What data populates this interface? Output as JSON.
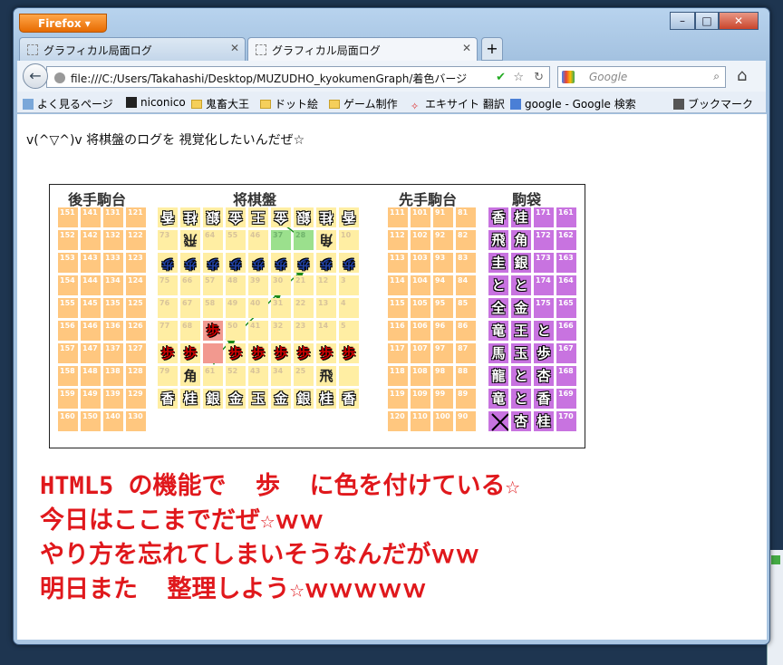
{
  "browser": {
    "app_button": "Firefox",
    "tabs": [
      {
        "title": "グラフィカル局面ログ"
      },
      {
        "title": "グラフィカル局面ログ"
      }
    ],
    "new_tab": "+",
    "url": "file:///C:/Users/Takahashi/Desktop/MUZUDHO_kyokumenGraph/着色バージ",
    "search_placeholder": "Google",
    "bookmarks": [
      {
        "label": "よく見るページ"
      },
      {
        "label": "niconico"
      },
      {
        "label": "鬼畜大王"
      },
      {
        "label": "ドット絵"
      },
      {
        "label": "ゲーム制作"
      },
      {
        "label": "エキサイト 翻訳"
      },
      {
        "label": "google - Google 検索"
      }
    ],
    "bookmark_menu": "ブックマーク",
    "window_controls": [
      "–",
      "□",
      "✕"
    ]
  },
  "page": {
    "intro": "v(^▽^)v 将棋盤のログを 視覚化したいんだぜ☆",
    "headers": {
      "gote_komadai": "後手駒台",
      "board": "将棋盤",
      "sente_komadai": "先手駒台",
      "komabukuro": "駒袋"
    },
    "messages": [
      "HTML5 の機能で  歩  に色を付けている☆",
      "今日はここまでだぜ☆ｗｗ",
      "やり方を忘れてしまいそうなんだがｗｗ",
      "明日また  整理しよう☆ｗｗｗｗｗ"
    ]
  },
  "gote_komadai": [
    [
      "151",
      "141",
      "131",
      "121"
    ],
    [
      "152",
      "142",
      "132",
      "122"
    ],
    [
      "153",
      "143",
      "133",
      "123"
    ],
    [
      "154",
      "144",
      "134",
      "124"
    ],
    [
      "155",
      "145",
      "135",
      "125"
    ],
    [
      "156",
      "146",
      "136",
      "126"
    ],
    [
      "157",
      "147",
      "137",
      "127"
    ],
    [
      "158",
      "148",
      "138",
      "128"
    ],
    [
      "159",
      "149",
      "139",
      "129"
    ],
    [
      "160",
      "150",
      "140",
      "130"
    ]
  ],
  "sente_komadai": [
    [
      "111",
      "101",
      "91",
      "81"
    ],
    [
      "112",
      "102",
      "92",
      "82"
    ],
    [
      "113",
      "103",
      "93",
      "83"
    ],
    [
      "114",
      "104",
      "94",
      "84"
    ],
    [
      "115",
      "105",
      "95",
      "85"
    ],
    [
      "116",
      "106",
      "96",
      "86"
    ],
    [
      "117",
      "107",
      "97",
      "87"
    ],
    [
      "118",
      "108",
      "98",
      "88"
    ],
    [
      "119",
      "109",
      "99",
      "89"
    ],
    [
      "120",
      "110",
      "100",
      "90"
    ]
  ],
  "board_numbers": [
    [
      "",
      "",
      "",
      "",
      "",
      "",
      "",
      "",
      ""
    ],
    [
      "73",
      "",
      "64",
      "55",
      "46",
      "37",
      "28",
      "",
      "10"
    ],
    [
      "",
      "",
      "",
      "",
      "",
      "",
      "",
      "",
      ""
    ],
    [
      "75",
      "66",
      "57",
      "48",
      "39",
      "30",
      "21",
      "12",
      "3"
    ],
    [
      "76",
      "67",
      "58",
      "49",
      "40",
      "31",
      "22",
      "13",
      "4"
    ],
    [
      "77",
      "68",
      "",
      "50",
      "41",
      "32",
      "23",
      "14",
      "5"
    ],
    [
      "",
      "",
      "",
      "",
      "",
      "",
      "",
      "",
      ""
    ],
    [
      "79",
      "",
      "61",
      "52",
      "43",
      "34",
      "25",
      "",
      ""
    ],
    [
      "",
      "",
      "",
      "",
      "",
      "",
      "",
      "",
      ""
    ]
  ],
  "board_pieces": [
    [
      "香",
      "桂",
      "銀",
      "金",
      "王",
      "金",
      "銀",
      "桂",
      "香"
    ],
    [
      "",
      "飛",
      "",
      "",
      "",
      "",
      "",
      "角",
      ""
    ],
    [
      "歩",
      "歩",
      "歩",
      "歩",
      "歩",
      "歩",
      "歩",
      "歩",
      "歩"
    ],
    [
      "",
      "",
      "",
      "",
      "",
      "",
      "",
      "",
      ""
    ],
    [
      "",
      "",
      "",
      "",
      "",
      "",
      "",
      "",
      ""
    ],
    [
      "",
      "",
      "歩",
      "",
      "",
      "",
      "",
      "",
      ""
    ],
    [
      "歩",
      "歩",
      "",
      "歩",
      "歩",
      "歩",
      "歩",
      "歩",
      "歩"
    ],
    [
      "",
      "角",
      "",
      "",
      "",
      "",
      "",
      "飛",
      ""
    ],
    [
      "香",
      "桂",
      "銀",
      "金",
      "玉",
      "金",
      "銀",
      "桂",
      "香"
    ]
  ],
  "komabukuro": [
    [
      "香",
      "桂",
      "171",
      "161"
    ],
    [
      "飛",
      "角",
      "172",
      "162"
    ],
    [
      "圭",
      "銀",
      "173",
      "163"
    ],
    [
      "と",
      "と",
      "174",
      "164"
    ],
    [
      "全",
      "金",
      "175",
      "165"
    ],
    [
      "竜",
      "王",
      "と",
      "166"
    ],
    [
      "馬",
      "玉",
      "歩",
      "167"
    ],
    [
      "龍",
      "と",
      "杏",
      "168"
    ],
    [
      "竜",
      "と",
      "香",
      "169"
    ],
    [
      "",
      "杏",
      "桂",
      "170"
    ]
  ],
  "colors": {
    "orange": "#ffc77f",
    "yellow": "#ffeea3",
    "green": "#9be08d",
    "purple": "#c873e0",
    "red": "#e0181c"
  }
}
